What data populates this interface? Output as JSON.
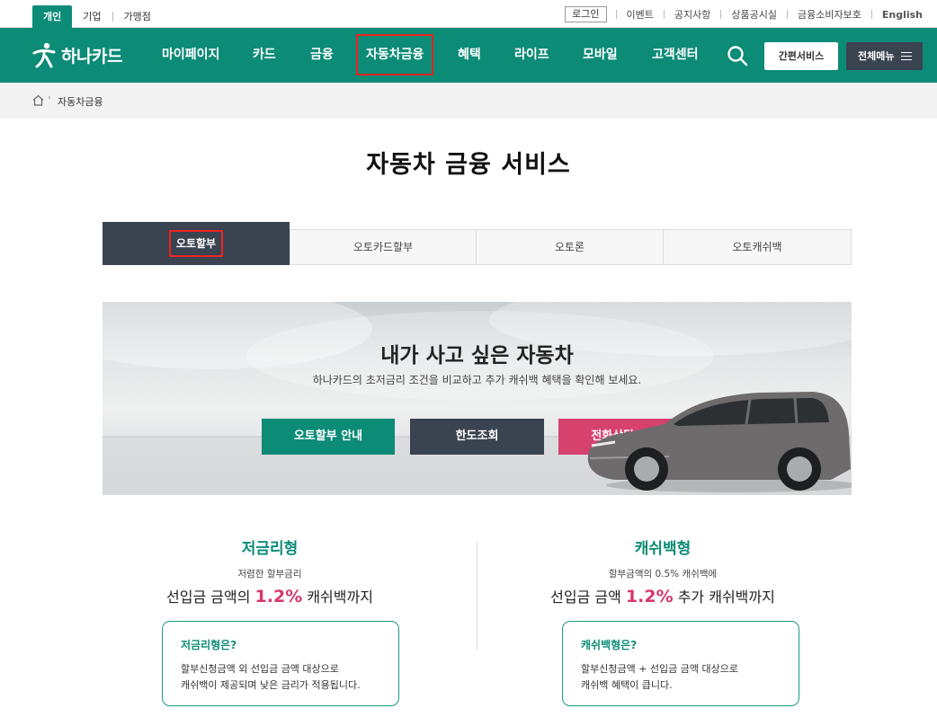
{
  "top": {
    "segments": [
      {
        "label": "개인",
        "active": true
      },
      {
        "label": "기업",
        "active": false
      },
      {
        "label": "가맹점",
        "active": false
      }
    ],
    "login": "로그인",
    "links": [
      "이벤트",
      "공지사항",
      "상품공시실",
      "금융소비자보호"
    ],
    "english": "English"
  },
  "gnb": {
    "logo": "하나카드",
    "menu": [
      "마이페이지",
      "카드",
      "금융",
      "자동차금융",
      "혜택",
      "라이프",
      "모바일",
      "고객센터"
    ],
    "quick": "간편서비스",
    "allmenu": "전체메뉴"
  },
  "breadcrumb": {
    "current": "자동차금융"
  },
  "page_title": "자동차 금융 서비스",
  "tabs": [
    "오토할부",
    "오토카드할부",
    "오토론",
    "오토캐쉬백"
  ],
  "hero": {
    "title": "내가 사고 싶은 자동차",
    "subtitle": "하나카드의 초저금리 조건을 비교하고 추가 캐쉬백 혜택을 확인해 보세요.",
    "buttons": [
      {
        "label": "오토할부 안내",
        "color": "#0c8b76"
      },
      {
        "label": "한도조회",
        "color": "#3a4350"
      },
      {
        "label": "전화상담 신청",
        "color": "#d6416e"
      }
    ]
  },
  "products": [
    {
      "name": "저금리형",
      "desc": "저렴한 할부금리",
      "head_pre": "선입금 금액의 ",
      "rate": "1.2%",
      "head_post": " 캐쉬백까지",
      "box_title": "저금리형은?",
      "box_line1": "할부신청금액 외 선입금 금액 대상으로",
      "box_line2": "캐쉬백이 제공되며 낮은 금리가 적용됩니다."
    },
    {
      "name": "캐쉬백형",
      "desc": "할부금액의 0.5% 캐쉬백에",
      "head_pre": "선입금 금액 ",
      "rate": "1.2%",
      "head_post": " 추가 캐쉬백까지",
      "box_title": "캐쉬백형은?",
      "box_line1": "할부신청금액 + 선입금 금액 대상으로",
      "box_line2": "캐쉬백 혜택이 큽니다."
    }
  ],
  "colors": {
    "brand": "#0c8b76",
    "dark": "#3a4350",
    "accent": "#d6386b"
  }
}
